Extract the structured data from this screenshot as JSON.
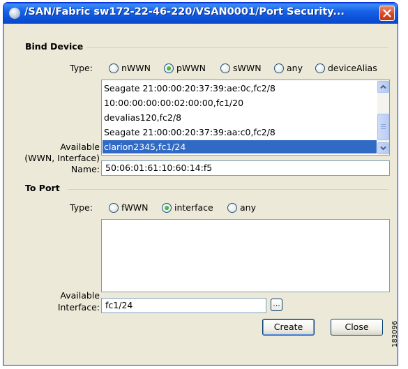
{
  "window": {
    "title": "/SAN/Fabric sw172-22-46-220/VSAN0001/Port Security..."
  },
  "bind_device": {
    "group_label": "Bind Device",
    "type_label": "Type:",
    "type_options": [
      "nWWN",
      "pWWN",
      "sWWN",
      "any",
      "deviceAlias"
    ],
    "type_selected": "pWWN",
    "available_label": [
      "Available",
      "(WWN, Interface)"
    ],
    "available_items": [
      "Seagate 21:00:00:20:37:39:ae:0c,fc2/8",
      "10:00:00:00:00:02:00:00,fc1/20",
      "devalias120,fc2/8",
      "Seagate 21:00:00:20:37:39:aa:c0,fc2/8",
      "clarion2345,fc1/24"
    ],
    "available_selected": "clarion2345,fc1/24",
    "name_label": "Name:",
    "name_value": "50:06:01:61:10:60:14:f5"
  },
  "to_port": {
    "group_label": "To Port",
    "type_label": "Type:",
    "type_options": [
      "fWWN",
      "interface",
      "any"
    ],
    "type_selected": "interface",
    "available_label": [
      "Available",
      "Interface:"
    ],
    "interface_value": "fc1/24",
    "browse_label": "..."
  },
  "buttons": {
    "create": "Create",
    "close": "Close"
  },
  "watermark": "183096",
  "icons": {
    "title": "window-app-icon",
    "close": "close-icon",
    "scroll_up": "chevron-up-icon",
    "scroll_down": "chevron-down-icon"
  }
}
